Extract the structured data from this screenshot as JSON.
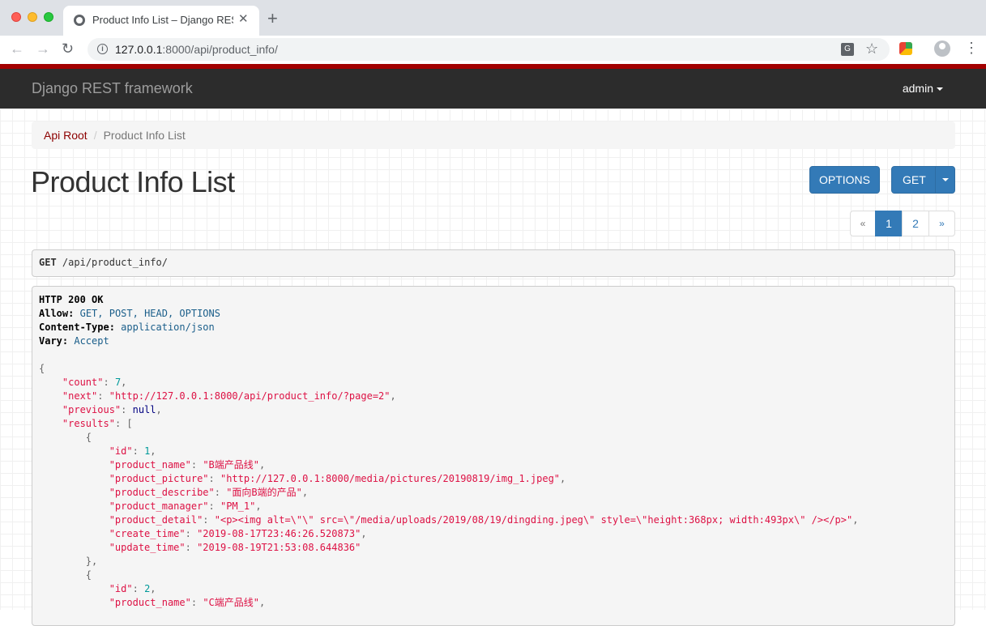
{
  "browser": {
    "tab_title": "Product Info List – Django REST framework",
    "url_host": "127.0.0.1",
    "url_rest": ":8000/api/product_info/"
  },
  "navbar": {
    "brand": "Django REST framework",
    "user": "admin"
  },
  "breadcrumb": {
    "root": "Api Root",
    "current": "Product Info List"
  },
  "page": {
    "title": "Product Info List",
    "options_label": "OPTIONS",
    "get_label": "GET"
  },
  "pagination": {
    "prev": "«",
    "pages": [
      "1",
      "2"
    ],
    "next": "»",
    "active": "1"
  },
  "request": {
    "method": "GET",
    "path": "/api/product_info/"
  },
  "response": {
    "status": "HTTP 200 OK",
    "headers": [
      {
        "key": "Allow:",
        "value": "GET, POST, HEAD, OPTIONS"
      },
      {
        "key": "Content-Type:",
        "value": "application/json"
      },
      {
        "key": "Vary:",
        "value": "Accept"
      }
    ],
    "count": "7",
    "next": "\"http://127.0.0.1:8000/api/product_info/?page=2\"",
    "previous": "null",
    "item1": {
      "id": "1",
      "product_name": "\"B端产品线\"",
      "product_picture": "\"http://127.0.0.1:8000/media/pictures/20190819/img_1.jpeg\"",
      "product_describe": "\"面向B端的产品\"",
      "product_manager": "\"PM_1\"",
      "product_detail": "\"<p><img alt=\\\"\\\" src=\\\"/media/uploads/2019/08/19/dingding.jpeg\\\" style=\\\"height:368px; width:493px\\\" /></p>\"",
      "create_time": "\"2019-08-17T23:46:26.520873\"",
      "update_time": "\"2019-08-19T21:53:08.644836\""
    },
    "item2": {
      "id": "2",
      "product_name": "\"C端产品线\""
    }
  }
}
